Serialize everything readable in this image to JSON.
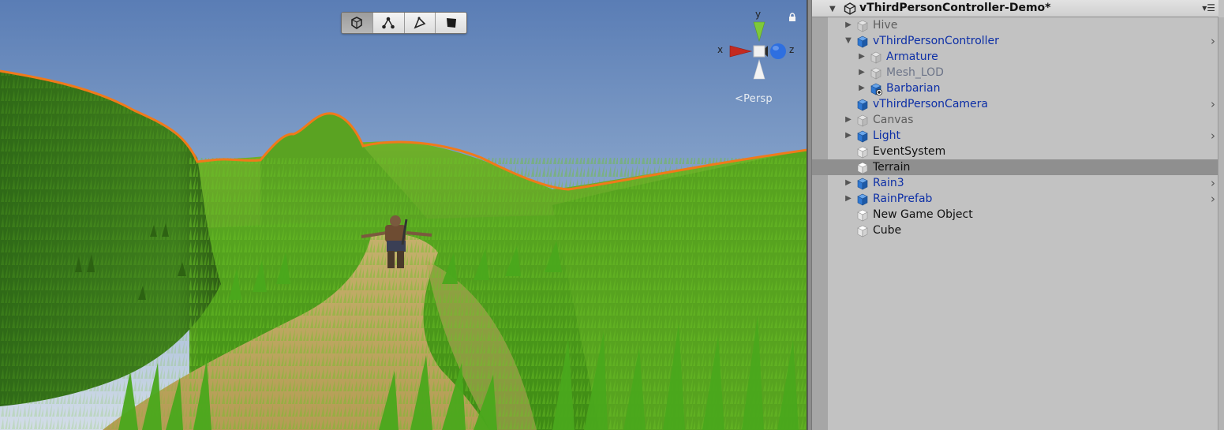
{
  "scene_view": {
    "tools": [
      {
        "name": "shaded-mode-icon",
        "active": true
      },
      {
        "name": "nodes-icon",
        "active": false
      },
      {
        "name": "pen-tool-icon",
        "active": false
      },
      {
        "name": "flag-icon",
        "active": false
      }
    ],
    "gizmo": {
      "x_label": "x",
      "y_label": "y",
      "z_label": "z"
    },
    "projection_label": "Persp"
  },
  "hierarchy": {
    "scene_name": "vThirdPersonController-Demo*",
    "items": [
      {
        "label": "Hive",
        "depth": 0,
        "expandable": true,
        "expanded": false,
        "style": "inactive-gray",
        "icon": "cube-gray-icon",
        "has_chevron": false
      },
      {
        "label": "vThirdPersonController",
        "depth": 0,
        "expandable": true,
        "expanded": true,
        "style": "prefab",
        "icon": "cube-blue-icon",
        "has_chevron": true
      },
      {
        "label": "Armature",
        "depth": 1,
        "expandable": true,
        "expanded": false,
        "style": "prefab",
        "icon": "cube-gray-icon",
        "has_chevron": false
      },
      {
        "label": "Mesh_LOD",
        "depth": 1,
        "expandable": true,
        "expanded": false,
        "style": "inactive",
        "icon": "cube-gray-icon",
        "has_chevron": false
      },
      {
        "label": "Barbarian",
        "depth": 1,
        "expandable": true,
        "expanded": false,
        "style": "prefab",
        "icon": "cube-blue-plus-icon",
        "has_chevron": false
      },
      {
        "label": "vThirdPersonCamera",
        "depth": 0,
        "expandable": false,
        "expanded": false,
        "style": "prefab",
        "icon": "cube-blue-icon",
        "has_chevron": true
      },
      {
        "label": "Canvas",
        "depth": 0,
        "expandable": true,
        "expanded": false,
        "style": "inactive-gray",
        "icon": "cube-gray-icon",
        "has_chevron": false
      },
      {
        "label": "Light",
        "depth": 0,
        "expandable": true,
        "expanded": false,
        "style": "prefab",
        "icon": "cube-blue-icon",
        "has_chevron": true
      },
      {
        "label": "EventSystem",
        "depth": 0,
        "expandable": false,
        "expanded": false,
        "style": "normal",
        "icon": "cube-white-icon",
        "has_chevron": false
      },
      {
        "label": "Terrain",
        "depth": 0,
        "expandable": false,
        "expanded": false,
        "style": "normal",
        "icon": "cube-white-icon",
        "has_chevron": false,
        "selected": true
      },
      {
        "label": "Rain3",
        "depth": 0,
        "expandable": true,
        "expanded": false,
        "style": "prefab",
        "icon": "cube-blue-icon",
        "has_chevron": true
      },
      {
        "label": "RainPrefab",
        "depth": 0,
        "expandable": true,
        "expanded": false,
        "style": "prefab",
        "icon": "cube-blue-icon",
        "has_chevron": true
      },
      {
        "label": "New Game Object",
        "depth": 0,
        "expandable": false,
        "expanded": false,
        "style": "normal",
        "icon": "cube-white-icon",
        "has_chevron": false
      },
      {
        "label": "Cube",
        "depth": 0,
        "expandable": false,
        "expanded": false,
        "style": "normal",
        "icon": "cube-white-icon",
        "has_chevron": false
      }
    ]
  },
  "colors": {
    "sky_top": "#5d80b7",
    "sky_bottom": "#c9d7e6",
    "grass": "#4f9a1e",
    "selection_outline": "#f07a1a",
    "path": "#c8b36a",
    "prefab_text": "#0d2fa6",
    "selected_row": "#8f8f8f"
  }
}
